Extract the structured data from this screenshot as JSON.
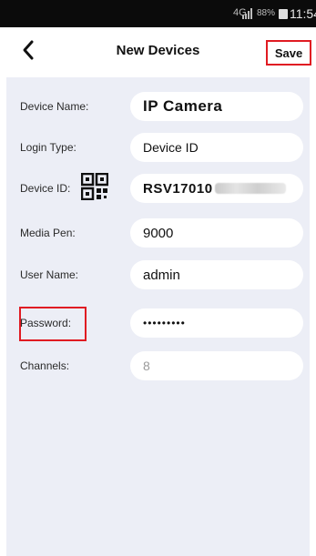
{
  "status_bar": {
    "signal": "4G",
    "battery_pct": "88%",
    "time": "11:54"
  },
  "header": {
    "title": "New Devices",
    "save_label": "Save"
  },
  "form": {
    "device_name": {
      "label": "Device Name:",
      "value": "IP Camera"
    },
    "login_type": {
      "label": "Login Type:",
      "value": "Device ID"
    },
    "device_id": {
      "label": "Device ID:",
      "value": "RSV17010"
    },
    "media_port": {
      "label": "Media Pen:",
      "value": "9000"
    },
    "user_name": {
      "label": "User Name:",
      "value": "admin"
    },
    "password": {
      "label": "Password:",
      "value": "•••••••••"
    },
    "channels": {
      "label": "Channels:",
      "value": "8"
    }
  },
  "colors": {
    "accent_highlight": "#e01b22",
    "panel_bg": "#eceef6",
    "status_bar_bg": "#0b0b0b"
  },
  "icons": [
    "back-chevron-icon",
    "qr-code-icon",
    "signal-icon",
    "battery-icon"
  ]
}
